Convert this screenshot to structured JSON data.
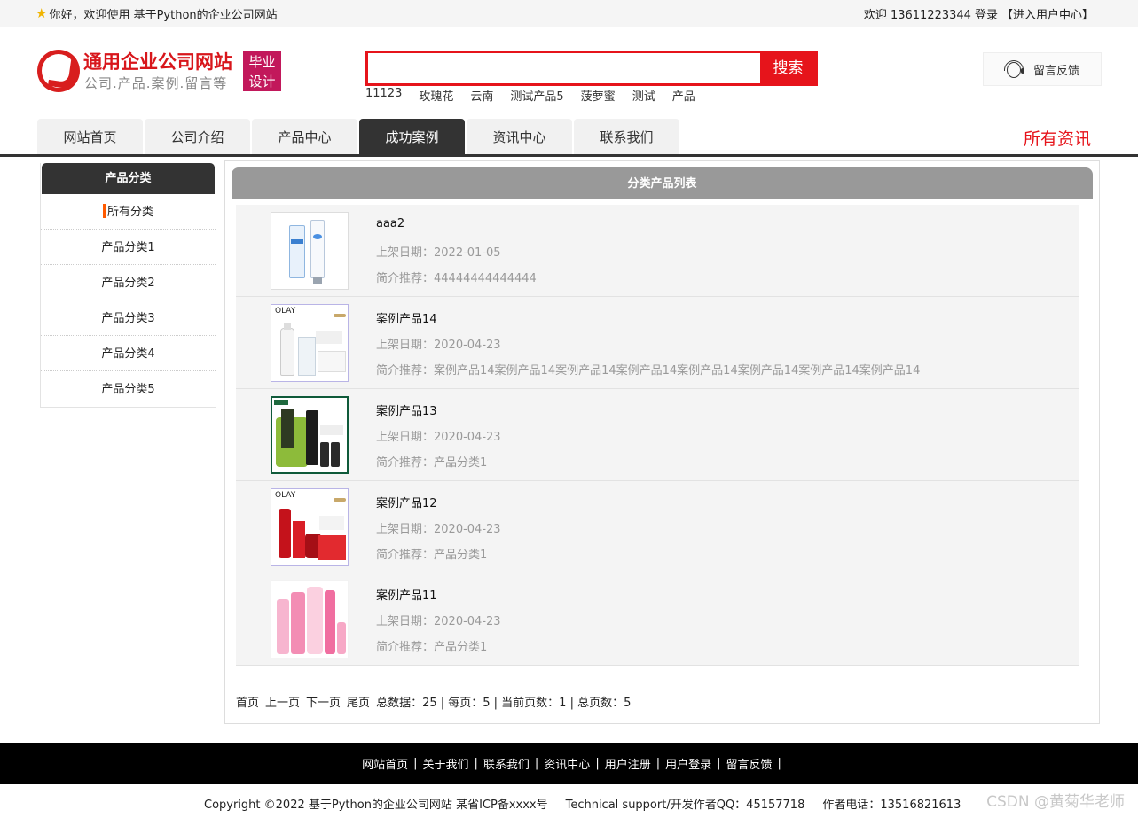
{
  "topbar": {
    "welcome": "你好，欢迎使用 基于Python的企业公司网站",
    "greeting": "欢迎 13611223344",
    "login": "登录",
    "user_center": "【进入用户中心】"
  },
  "header": {
    "logo_title": "通用企业公司网站",
    "logo_subtitle": "公司.产品.案例.留言等",
    "logo_badge_line1": "毕业",
    "logo_badge_line2": "设计",
    "search_placeholder": "",
    "search_button": "搜索",
    "hot_words": [
      "11123",
      "玫瑰花",
      "云南",
      "测试产品5",
      "菠萝蜜",
      "测试",
      "产品"
    ],
    "feedback": "留言反馈"
  },
  "nav": {
    "items": [
      "网站首页",
      "公司介绍",
      "产品中心",
      "成功案例",
      "资讯中心",
      "联系我们"
    ],
    "active_index": 3,
    "right_label": "所有资讯"
  },
  "sidebar": {
    "title": "产品分类",
    "items": [
      "所有分类",
      "产品分类1",
      "产品分类2",
      "产品分类3",
      "产品分类4",
      "产品分类5"
    ]
  },
  "main": {
    "title": "分类产品列表",
    "products": [
      {
        "name": "aaa2",
        "date": "上架日期：2022-01-05",
        "desc": "简介推荐：44444444444444"
      },
      {
        "name": "案例产品14",
        "date": "上架日期：2020-04-23",
        "desc": "简介推荐：案例产品14案例产品14案例产品14案例产品14案例产品14案例产品14案例产品14案例产品14"
      },
      {
        "name": "案例产品13",
        "date": "上架日期：2020-04-23",
        "desc": "简介推荐：产品分类1"
      },
      {
        "name": "案例产品12",
        "date": "上架日期：2020-04-23",
        "desc": "简介推荐：产品分类1"
      },
      {
        "name": "案例产品11",
        "date": "上架日期：2020-04-23",
        "desc": "简介推荐：产品分类1"
      }
    ],
    "thumb_labels": {
      "olay1": "OLAY",
      "olay2": "OLAY"
    }
  },
  "pager": {
    "first": "首页",
    "prev": "上一页",
    "next": "下一页",
    "last": "尾页",
    "summary": "总数据：25 | 每页：5 | 当前页数：1 | 总页数：5"
  },
  "footer": {
    "links": [
      "网站首页",
      "关于我们",
      "联系我们",
      "资讯中心",
      "用户注册",
      "用户登录",
      "留言反馈"
    ],
    "copyright": "Copyright ©2022 基于Python的企业公司网站 某省ICP备xxxx号",
    "support": "Technical support/开发作者QQ：45157718",
    "phone": "作者电话：13516821613",
    "watermark": "CSDN @黄菊华老师"
  },
  "colors": {
    "accent": "#e6141b",
    "nav_active": "#333333",
    "badge": "#c2185b",
    "side_marker": "#ff5a00"
  }
}
